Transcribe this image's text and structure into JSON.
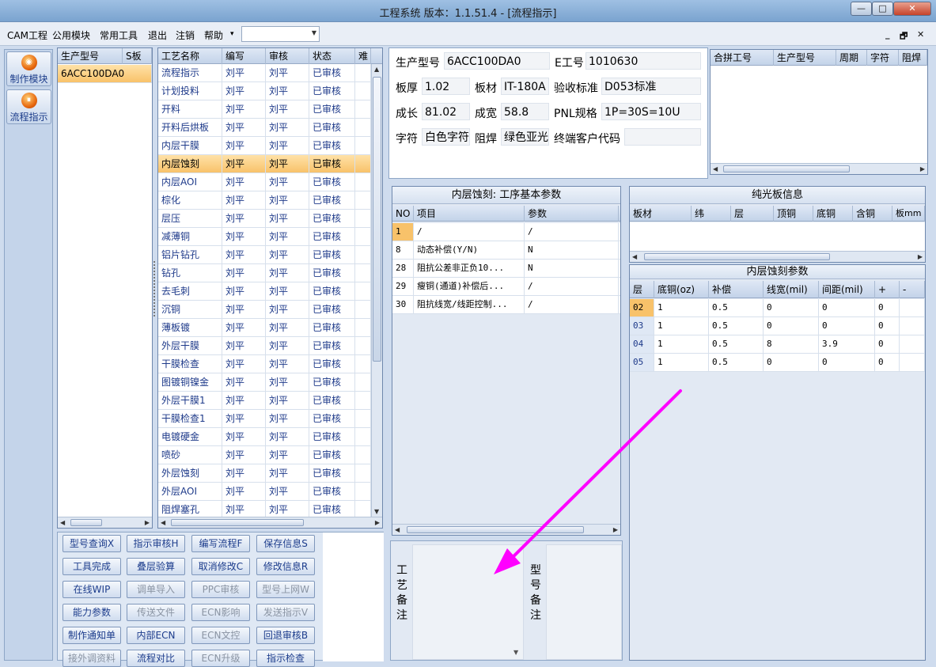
{
  "window": {
    "title": "工程系统  版本：1.1.51.4 - [流程指示]",
    "min": "—",
    "max": "□",
    "close": "✕"
  },
  "menubar": {
    "items": [
      "CAM工程",
      "公用模块",
      "常用工具",
      "退出",
      "注销",
      "帮助"
    ],
    "help_arrow": "▾",
    "combo_value": "",
    "mdi_controls": [
      "_",
      "🗗",
      "✕"
    ]
  },
  "leftnav": {
    "items": [
      {
        "label": "制作模块",
        "icon": "production-module-icon"
      },
      {
        "label": "流程指示",
        "icon": "process-guide-icon"
      }
    ]
  },
  "models_grid": {
    "columns": [
      "生产型号",
      "S板"
    ],
    "rows": [
      [
        "6ACC100DA0",
        ""
      ]
    ]
  },
  "process_grid": {
    "columns": [
      "工艺名称",
      "编写",
      "审核",
      "状态",
      "难"
    ],
    "selected_index": 5,
    "rows": [
      [
        "流程指示",
        "刘平",
        "刘平",
        "已审核"
      ],
      [
        "计划投料",
        "刘平",
        "刘平",
        "已审核"
      ],
      [
        "开料",
        "刘平",
        "刘平",
        "已审核"
      ],
      [
        "开料后烘板",
        "刘平",
        "刘平",
        "已审核"
      ],
      [
        "内层干膜",
        "刘平",
        "刘平",
        "已审核"
      ],
      [
        "内层蚀刻",
        "刘平",
        "刘平",
        "已审核"
      ],
      [
        "内层AOI",
        "刘平",
        "刘平",
        "已审核"
      ],
      [
        "棕化",
        "刘平",
        "刘平",
        "已审核"
      ],
      [
        "层压",
        "刘平",
        "刘平",
        "已审核"
      ],
      [
        "减薄铜",
        "刘平",
        "刘平",
        "已审核"
      ],
      [
        "铝片钻孔",
        "刘平",
        "刘平",
        "已审核"
      ],
      [
        "钻孔",
        "刘平",
        "刘平",
        "已审核"
      ],
      [
        "去毛刺",
        "刘平",
        "刘平",
        "已审核"
      ],
      [
        "沉铜",
        "刘平",
        "刘平",
        "已审核"
      ],
      [
        "薄板镀",
        "刘平",
        "刘平",
        "已审核"
      ],
      [
        "外层干膜",
        "刘平",
        "刘平",
        "已审核"
      ],
      [
        "干膜检查",
        "刘平",
        "刘平",
        "已审核"
      ],
      [
        "图镀铜镍金",
        "刘平",
        "刘平",
        "已审核"
      ],
      [
        "外层干膜1",
        "刘平",
        "刘平",
        "已审核"
      ],
      [
        "干膜检查1",
        "刘平",
        "刘平",
        "已审核"
      ],
      [
        "电镀硬金",
        "刘平",
        "刘平",
        "已审核"
      ],
      [
        "喷砂",
        "刘平",
        "刘平",
        "已审核"
      ],
      [
        "外层蚀刻",
        "刘平",
        "刘平",
        "已审核"
      ],
      [
        "外层AOI",
        "刘平",
        "刘平",
        "已审核"
      ],
      [
        "阻焊塞孔",
        "刘平",
        "刘平",
        "已审核"
      ]
    ]
  },
  "info": {
    "model_label": "生产型号",
    "model_value": "6ACC100DA0",
    "eno_label": "E工号",
    "eno_value": "1010630",
    "thickness_label": "板厚",
    "thickness_value": "1.02",
    "material_label": "板材",
    "material_value": "IT-180A",
    "standard_label": "验收标准",
    "standard_value": "D053标准",
    "length_label": "成长",
    "length_value": "81.02",
    "width_label": "成宽",
    "width_value": "58.8",
    "pnl_label": "PNL规格",
    "pnl_value": "1P=30S=10U",
    "char_label": "字符",
    "char_value": "白色字符",
    "mask_label": "阻焊",
    "mask_value": "绿色亚光",
    "customer_label": "终端客户代码",
    "customer_value": ""
  },
  "panel_grid": {
    "columns": [
      "合拼工号",
      "生产型号",
      "周期",
      "字符",
      "阻焊"
    ]
  },
  "base_params": {
    "title": "内层蚀刻: 工序基本参数",
    "columns": [
      "NO",
      "项目",
      "参数"
    ],
    "rows": [
      [
        "1",
        "/",
        "/"
      ],
      [
        "8",
        "动态补偿(Y/N)",
        "N"
      ],
      [
        "28",
        "阻抗公差非正负10...",
        "N"
      ],
      [
        "29",
        "瘦铜(通道)补偿后...",
        "/"
      ],
      [
        "30",
        "阻抗线宽/线距控制...",
        "/"
      ]
    ]
  },
  "bare_board": {
    "title": "纯光板信息",
    "columns": [
      "板材",
      "纬",
      "层",
      "顶铜",
      "底铜",
      "含铜",
      "板mm"
    ]
  },
  "etch_params": {
    "title": "内层蚀刻参数",
    "columns": [
      "层",
      "底铜(oz)",
      "补偿",
      "线宽(mil)",
      "间距(mil)",
      "+",
      "-"
    ],
    "rows": [
      [
        "02",
        "1",
        "0.5",
        "0",
        "0",
        "0",
        ""
      ],
      [
        "03",
        "1",
        "0.5",
        "0",
        "0",
        "0",
        ""
      ],
      [
        "04",
        "1",
        "0.5",
        "8",
        "3.9",
        "0",
        ""
      ],
      [
        "05",
        "1",
        "0.5",
        "0",
        "0",
        "0",
        ""
      ]
    ]
  },
  "actions": {
    "rows": [
      [
        {
          "l": "型号查询X",
          "d": false
        },
        {
          "l": "指示审核H",
          "d": false
        },
        {
          "l": "编写流程F",
          "d": false
        },
        {
          "l": "保存信息S",
          "d": false
        }
      ],
      [
        {
          "l": "工具完成",
          "d": false
        },
        {
          "l": "叠层验算",
          "d": false
        },
        {
          "l": "取消修改C",
          "d": false
        },
        {
          "l": "修改信息R",
          "d": false
        }
      ],
      [
        {
          "l": "在线WIP",
          "d": false
        },
        {
          "l": "调单导入",
          "d": true
        },
        {
          "l": "PPC审核",
          "d": true
        },
        {
          "l": "型号上网W",
          "d": true
        }
      ],
      [
        {
          "l": "能力参数",
          "d": false
        },
        {
          "l": "传送文件",
          "d": true
        },
        {
          "l": "ECN影响",
          "d": true
        },
        {
          "l": "发送指示V",
          "d": true
        }
      ],
      [
        {
          "l": "制作通知单",
          "d": false
        },
        {
          "l": "内部ECN",
          "d": false
        },
        {
          "l": "ECN文控",
          "d": true
        },
        {
          "l": "回退审核B",
          "d": false
        }
      ],
      [
        {
          "l": "接外调资料",
          "d": true
        },
        {
          "l": "流程对比",
          "d": false
        },
        {
          "l": "ECN升级",
          "d": true
        },
        {
          "l": "指示检查",
          "d": false
        }
      ]
    ]
  },
  "remarks": {
    "process_label": [
      "工",
      "艺",
      "备",
      "注"
    ],
    "model_label": [
      "型",
      "号",
      "备",
      "注"
    ],
    "process_value": "",
    "model_value": ""
  },
  "annotation": {
    "color": "#ff00ff"
  }
}
